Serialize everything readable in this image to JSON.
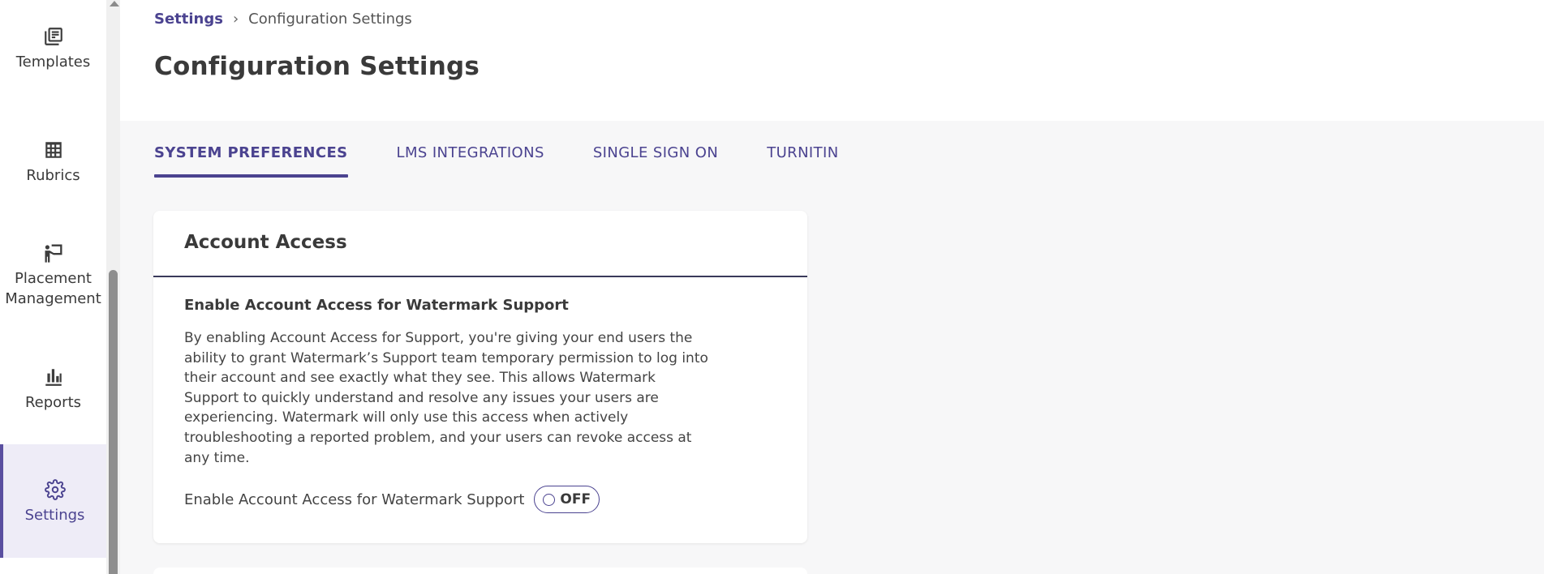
{
  "sidebar": {
    "items": [
      {
        "label": "Templates",
        "icon": "templates-icon"
      },
      {
        "label": "Rubrics",
        "icon": "grid-icon"
      },
      {
        "label": "Placement Management",
        "label_line1": "Placement",
        "label_line2": "Management",
        "icon": "presenter-icon"
      },
      {
        "label": "Reports",
        "icon": "bar-chart-icon"
      },
      {
        "label": "Settings",
        "icon": "gear-icon",
        "active": true
      }
    ]
  },
  "breadcrumb": {
    "parent": "Settings",
    "separator": "›",
    "current": "Configuration Settings"
  },
  "page": {
    "title": "Configuration Settings"
  },
  "tabs": [
    {
      "label": "SYSTEM PREFERENCES",
      "active": true
    },
    {
      "label": "LMS INTEGRATIONS"
    },
    {
      "label": "SINGLE SIGN ON"
    },
    {
      "label": "TURNITIN"
    }
  ],
  "account_access": {
    "title": "Account Access",
    "section_title": "Enable Account Access for Watermark Support",
    "description": "By enabling Account Access for Support, you're giving your end users the ability to grant Watermark’s Support team temporary permission to log into their account and see exactly what they see. This allows Watermark Support to quickly understand and resolve any issues your users are experiencing. Watermark will only use this access when actively troubleshooting a reported problem, and your users can revoke access at any time.",
    "toggle_label": "Enable Account Access for Watermark Support",
    "toggle_state": "OFF"
  },
  "colors": {
    "accent": "#4b4390",
    "active_bg": "#eeecf7",
    "page_bg": "#f7f7f8"
  }
}
